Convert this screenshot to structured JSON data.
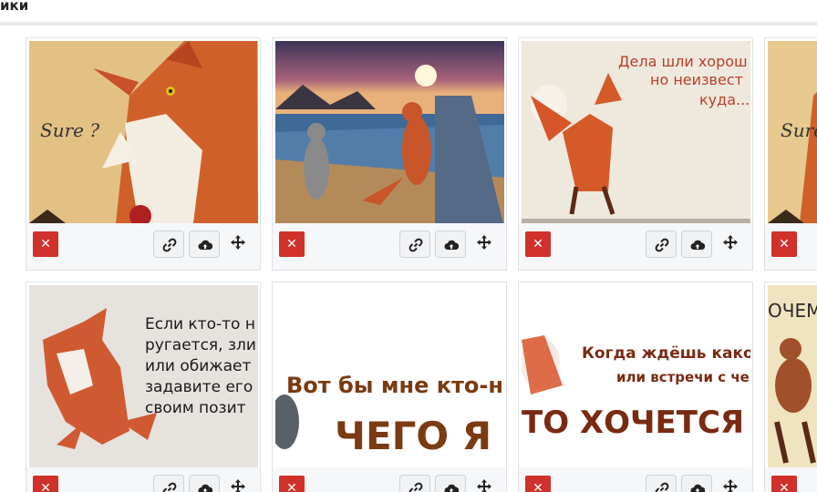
{
  "header": {
    "title": "ики"
  },
  "images": [
    {
      "id": "c1",
      "caption_lines": [
        "Sure ?"
      ]
    },
    {
      "id": "c2",
      "caption_lines": []
    },
    {
      "id": "c3",
      "caption_lines": [
        "Дела шли хорош",
        "но неизвест",
        "куда..."
      ]
    },
    {
      "id": "c4",
      "caption_lines": [
        "Sure"
      ]
    },
    {
      "id": "c5",
      "caption_lines": [
        "Если кто-то н",
        "ругается, зли",
        "или обижает",
        "задавите его",
        "своим позит"
      ]
    },
    {
      "id": "c6",
      "caption_lines": [
        "Вот бы мне кто-нибу",
        "ЧЕГО Я ХО"
      ]
    },
    {
      "id": "c7",
      "caption_lines": [
        "Когда ждёшь какого",
        "или встречи с че",
        "ТО ХОЧЕТСЯ ЖИ"
      ]
    },
    {
      "id": "c8",
      "caption_lines": [
        "ОЧЕМ"
      ]
    }
  ],
  "buttons": {
    "delete_glyph": "✕"
  },
  "icons": [
    "close-icon",
    "link-icon",
    "cloud-upload-icon",
    "move-arrows-icon"
  ],
  "colors": {
    "delete_button": "#d1312b",
    "toolbar_bg": "#f6f7f9",
    "card_border": "#dfe2e6"
  }
}
